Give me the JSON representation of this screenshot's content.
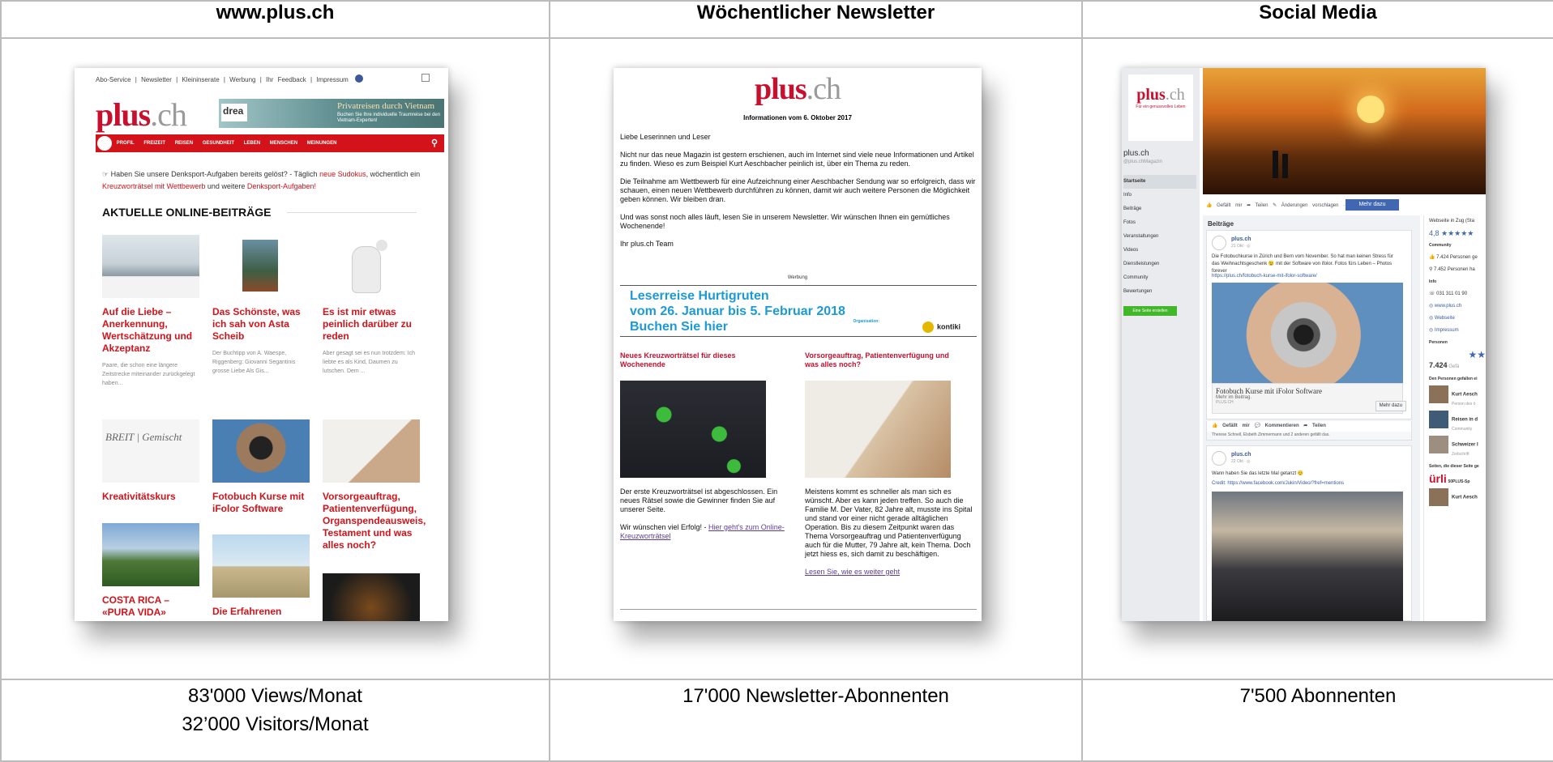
{
  "headers": {
    "col1": "www.plus.ch",
    "col2": "Wöchentlicher Newsletter",
    "col3": "Social Media"
  },
  "footers": {
    "col1_line1": "83'000 Views/Monat",
    "col1_line2": "32’000 Visitors/Monat",
    "col2": "17'000 Newsletter-Abonnenten",
    "col3": "7'500 Abonnenten"
  },
  "website": {
    "top_links": "Abo-Service | Newsletter | Kleininserate | Werbung | Ihr Feedback | Impressum",
    "logo_main": "plus",
    "logo_suffix": ".ch",
    "banner_logo": "drea",
    "banner_title": "Privatreisen durch Vietnam",
    "banner_sub": "Buchen Sie Ihre individuelle Traumreise bei den Vietnam-Experten!",
    "nav": [
      "PROFIL",
      "FREIZEIT",
      "REISEN",
      "GESUNDHEIT",
      "LEBEN",
      "MENSCHEN",
      "MEINUNGEN"
    ],
    "promo_text_1": "Haben Sie unsere Denksport-Aufgaben bereits gelöst? - Täglich ",
    "promo_link_1": "neue Sudokus",
    "promo_text_2": ", wöchentlich ein ",
    "promo_link_2": "Kreuzworträtsel mit Wettbewerb",
    "promo_text_3": " und weitere ",
    "promo_link_3": "Denksport-Aufgaben!",
    "section_title": "AKTUELLE ONLINE-BEITRÄGE",
    "articles": [
      {
        "title": "Auf die Liebe – Anerkennung, Wertschätzung und Akzeptanz",
        "teaser": "Paare, die schon eine längere Zeitstrecke miteinander zurückgelegt haben..."
      },
      {
        "title": "Das Schönste, was ich sah von Asta Scheib",
        "teaser": "Der Buchtipp von A. Waespe, Riggenberg: Giovanni Segantinis grosse Liebe Als Gis..."
      },
      {
        "title": "Es ist mir etwas peinlich darüber zu reden",
        "teaser": "Aber gesagt sei es nun trotzdem: Ich liebte es als Kind, Daumen zu lutschen. Dem ..."
      },
      {
        "title": "Kreativitätskurs",
        "teaser": ""
      },
      {
        "title": "Fotobuch Kurse mit iFolor Software",
        "teaser": ""
      },
      {
        "title": "Vorsorgeauftrag, Patientenverfügung, Organspendeausweis, Testament und was alles noch?",
        "teaser": ""
      },
      {
        "title": "COSTA RICA – «PURA VIDA»",
        "teaser": ""
      },
      {
        "title": "Die Erfahrenen",
        "teaser": ""
      }
    ]
  },
  "newsletter": {
    "logo_main": "plus",
    "logo_suffix": ".ch",
    "date_line": "Informationen vom 6. Oktober 2017",
    "greeting": "Liebe Leserinnen und Leser",
    "para1": "Nicht nur das neue Magazin ist gestern erschienen, auch im Internet sind viele neue Informationen und Artikel zu finden. Wieso es zum Beispiel Kurt Aeschbacher peinlich ist, über ein Thema zu reden.",
    "para2": "Die Teilnahme am Wettbewerb für eine Aufzeichnung einer Aeschbacher Sendung war so erfolgreich, dass wir schauen, einen neuen Wettbewerb durchführen zu können, damit wir auch weitere Personen die Möglichkeit geben können. Wir bleiben dran.",
    "para3": "Und was sonst noch alles läuft, lesen Sie in unserem Newsletter. Wir wünschen Ihnen ein gemütliches Wochenende!",
    "signoff": "Ihr plus.ch Team",
    "ad_label": "Werbung",
    "ad_line1": "Leserreise Hurtigruten",
    "ad_line2": "vom 26. Januar bis 5. Februar 2018",
    "ad_line3": "Buchen Sie hier",
    "ad_org": "Organisation:",
    "ad_brand": "kontiki",
    "left_heading": "Neues Kreuzworträtsel für dieses Wochenende",
    "left_text": "Der erste Kreuzworträtsel ist abgeschlossen. Ein neues Rätsel sowie die Gewinner finden Sie auf unserer Seite.",
    "left_text2": "Wir wünschen viel Erfolg! - ",
    "left_link": "Hier geht's zum Online-Kreuzworträtsel",
    "right_heading": "Vorsorgeauftrag, Patientenverfügung und was alles noch?",
    "right_text": "Meistens kommt es schneller als man sich es wünscht. Aber es kann jeden treffen. So auch die Familie M. Der Vater, 82 Jahre alt, musste ins Spital und stand vor einer nicht gerade alltäglichen Operation. Bis zu diesem Zeitpunkt waren das Thema Vorsorgeauftrag und Patientenverfügung auch für die Mutter, 79 Jahre alt, kein Thema. Doch jetzt hiess es, sich damit zu beschäftigen.",
    "right_link": "Lesen Sie, wie es weiter geht"
  },
  "social": {
    "logo_main": "plus",
    "logo_suffix": ".ch",
    "logo_sub": "Für ein genussvolles Leben",
    "page_name": "plus.ch",
    "handle": "@plus.chMagazin",
    "nav": [
      "Startseite",
      "Info",
      "Beiträge",
      "Fotos",
      "Veranstaltungen",
      "Videos",
      "Dienstleistungen",
      "Community",
      "Bewertungen"
    ],
    "create_btn": "Eine Seite erstellen",
    "actions": "👍 Gefällt mir  ➦ Teilen  ✎ Änderungen vorschlagen  ···",
    "more_btn": "Mehr dazu",
    "feed_label": "Beiträge",
    "post1_author": "plus.ch",
    "post1_time": "21 Okt · ◎",
    "post1_text": "Die Fotobuchkurse in Zürich und Bern vom November. So hat man keinen Stress für das Weihnachtsgeschenk 😉 mit der Software von ifolor. Fotos fürs Leben – Photos forever",
    "post1_link": "https://plus.ch/fotobuch-kurse-mit-ifolor-software/",
    "post1_caption": "Fotobuch Kurse mit iFolor Software",
    "post1_caption_sub": "Mehr im Beitrag.",
    "post1_domain": "PLUS.CH",
    "post1_more": "Mehr dazu",
    "post1_actions": "👍 Gefällt mir   💬 Kommentieren   ➦ Teilen",
    "post1_likes": "Therese Schnell, Elsbeth Zimmermann und 2 anderen gefällt das.",
    "post2_author": "plus.ch",
    "post2_time": "22 Okt · ◎",
    "post2_text": "Wann haben Sie das letzte Mal getanzt 😊",
    "post2_credit": "Credit: https://www.facebook.com/Jukin/Video/?fref=mentions",
    "right_website": "Webseite in Zug (Sta",
    "right_rating": "4,8 ★★★★★",
    "right_community": "Community",
    "right_likes": "👍 7.424 Personen ge",
    "right_follows": "⚲ 7.452 Personen ha",
    "right_info": "Info",
    "right_phone": "☏ 031 311 01 90",
    "right_web": "◎ www.plus.ch",
    "right_web2": "◎ Webseite",
    "right_impressum": "◎ Impressum",
    "right_persons": "Personen",
    "right_count": "7.424",
    "right_count_suffix": " Gefä",
    "right_liked_head": "Den Personen gefallen ei",
    "right_p1": "Kurt Aesch",
    "right_p1_sub": "Person des ö",
    "right_p2": "Reisen in d",
    "right_p2_sub": "Community",
    "right_p3": "Schweizer I",
    "right_p3_sub": "Zeitschrift",
    "right_pages_head": "Seiten, die dieser Seite ge",
    "right_brand": "ürli",
    "right_brand_sub": "50PLUS-Sp",
    "right_p4": "Kurt Aesch"
  }
}
